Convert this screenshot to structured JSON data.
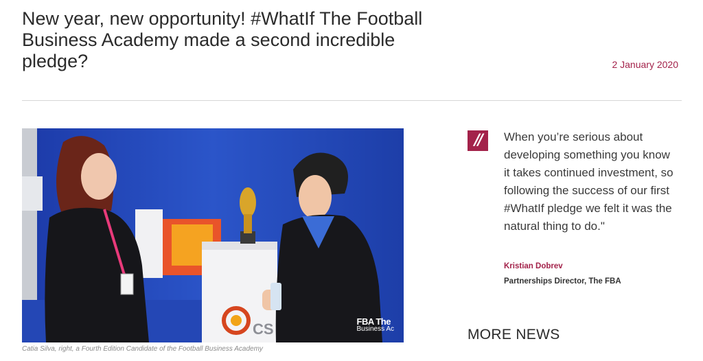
{
  "article": {
    "title": "New year, new opportunity! #WhatIf The Football Business Academy made a second incredible pledge?",
    "date": "2 January 2020"
  },
  "photo": {
    "watermark_line1": "FBA The",
    "watermark_line2": "Business Ac",
    "banner_text": "CS",
    "caption": "Catia Silva, right, a Fourth Edition Candidate of the Football Business Academy"
  },
  "quote": {
    "mark": "//",
    "text": "When you’re serious about developing something you know it takes continued investment, so following the success of our first #WhatIf pledge we felt it was the natural thing to do.\"",
    "author": "Kristian Dobrev",
    "role": "Partnerships Director, The FBA"
  },
  "more_news": {
    "label": "MORE NEWS"
  },
  "colors": {
    "accent": "#a3224a",
    "photo_background": "#1f3fae"
  }
}
